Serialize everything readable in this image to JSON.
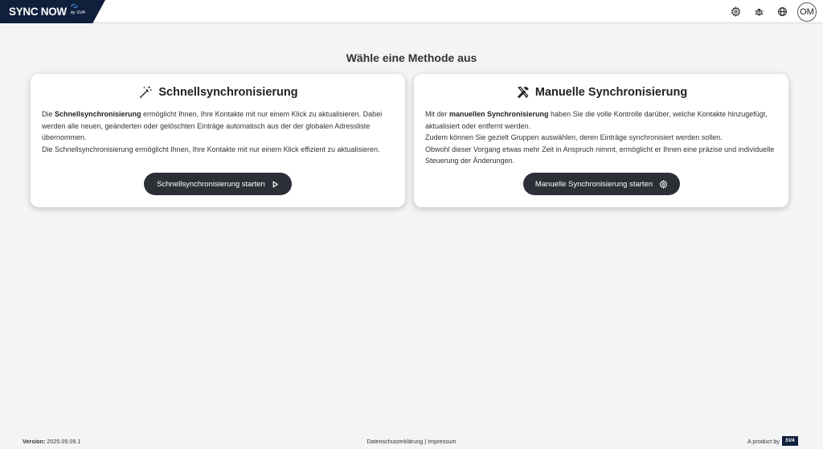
{
  "app": {
    "logo_text": "SYNC NOW",
    "logo_sub": "by SVA",
    "avatar_initials": "OM",
    "brand_color": "#0f1f3c",
    "icons": [
      "gear-icon",
      "bug-icon",
      "globe-icon",
      "avatar"
    ]
  },
  "main": {
    "heading": "Wähle eine Methode aus"
  },
  "quick": {
    "title": "Schnellsynchronisierung",
    "icon": "magic-wand-icon",
    "p1_prefix": "Die ",
    "p1_bold": "Schnellsynchronisierung",
    "p1_rest": " ermöglicht Ihnen, Ihre Kontakte mit nur einem Klick zu aktualisieren. Dabei werden alle neuen, geänderten oder gelöschten Einträge automatisch aus der der globalen Adressliste übernommen.",
    "p2": "Die Schnellsynchronisierung ermöglicht Ihnen, Ihre Kontakte mit nur einem Klick effizient zu aktualisieren.",
    "button_label": "Schnellsynchronisierung starten",
    "button_icon": "play-icon"
  },
  "manual": {
    "title": "Manuelle Synchronisierung",
    "icon": "tools-icon",
    "p1_prefix": "Mit der ",
    "p1_bold": "manuellen Synchronisierung",
    "p1_rest": " haben Sie die volle Kontrolle darüber, welche Kontakte hinzugefügt, aktualisiert oder entfernt werden.",
    "p2": "Zudem können Sie gezielt Gruppen auswählen, deren Einträge synchronisiert werden sollen.",
    "p3": "Obwohl dieser Vorgang etwas mehr Zeit in Anspruch nimmt, ermöglicht er Ihnen eine präzise und individuelle Steuerung der Änderungen.",
    "button_label": "Manuelle Synchronisierung starten",
    "button_icon": "gear-icon"
  },
  "footer": {
    "version_label": "Version:",
    "version_value": "2025.09.09.1",
    "privacy_link": "Datenschutzerklärung",
    "separator": "|",
    "imprint_link": "Impressum",
    "product_text": "A product by",
    "product_badge": "SVA"
  }
}
